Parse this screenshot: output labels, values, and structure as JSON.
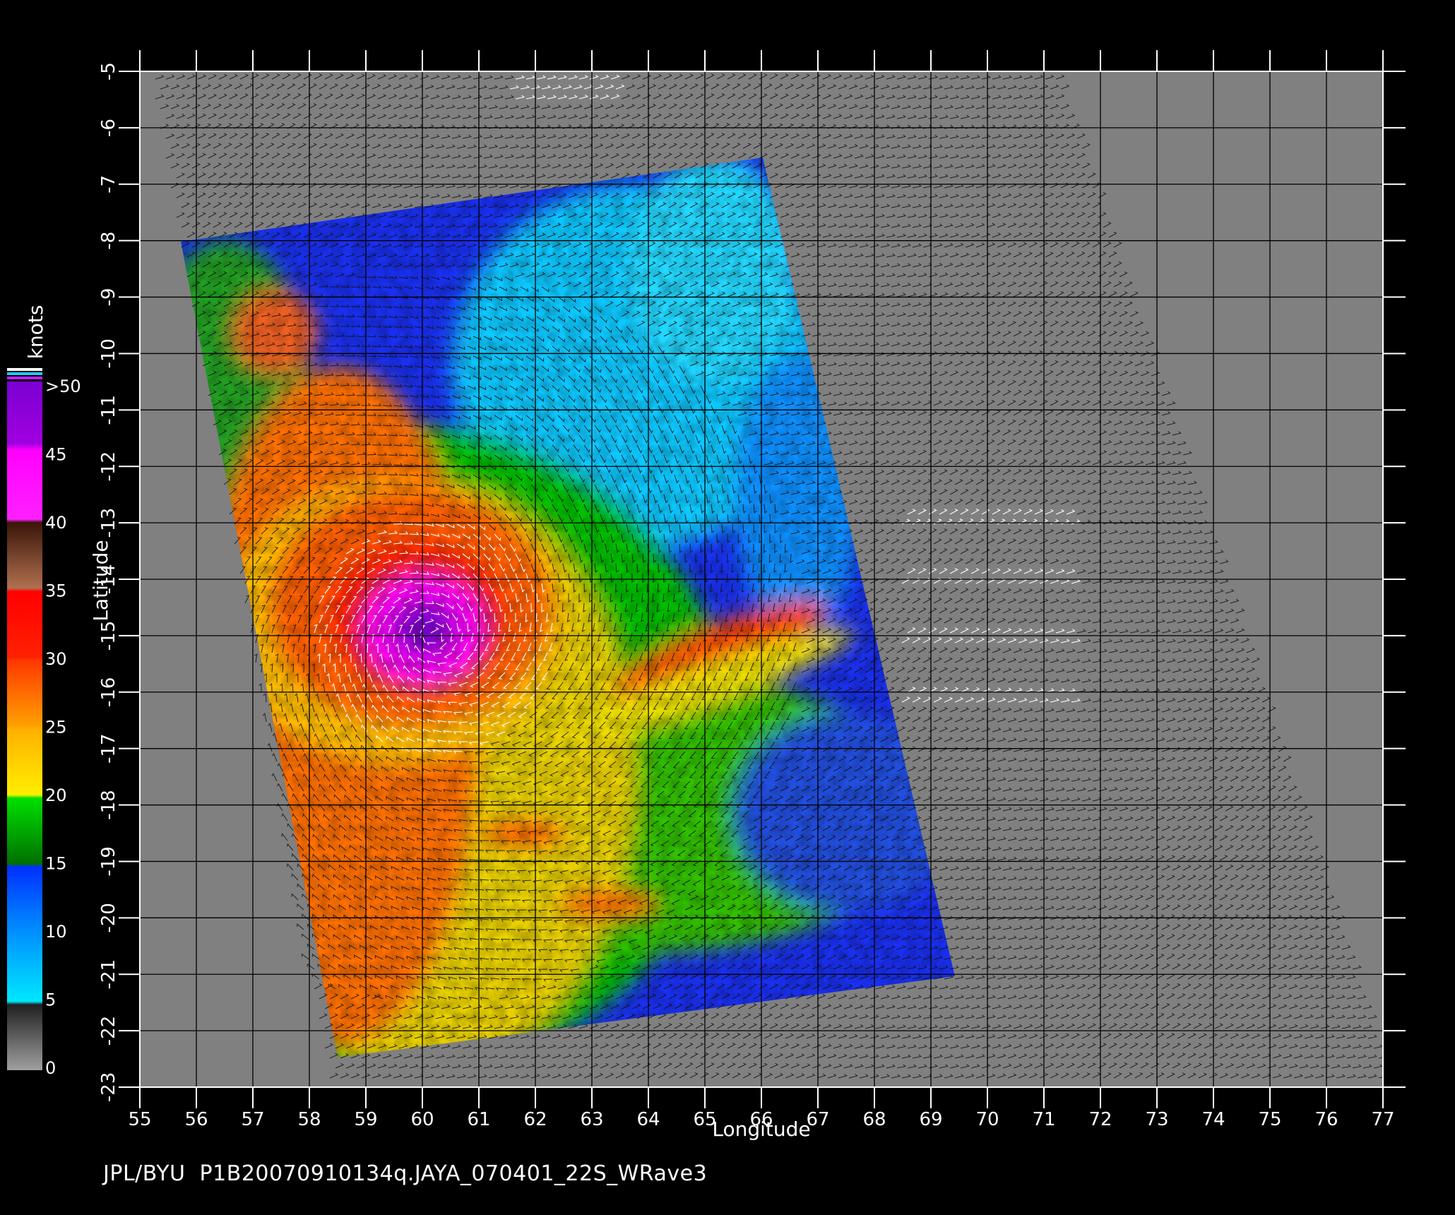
{
  "map": {
    "xlabel": "Longitude",
    "ylabel": "Latitude",
    "x_ticks": [
      "55",
      "56",
      "57",
      "58",
      "59",
      "60",
      "61",
      "62",
      "63",
      "64",
      "65",
      "66",
      "67",
      "68",
      "69",
      "70",
      "71",
      "72",
      "73",
      "74",
      "75",
      "76",
      "77"
    ],
    "y_ticks": [
      "-5",
      "-6",
      "-7",
      "-8",
      "-9",
      "-10",
      "-11",
      "-12",
      "-13",
      "-14",
      "-15",
      "-16",
      "-17",
      "-18",
      "-19",
      "-20",
      "-21",
      "-22",
      "-23"
    ],
    "lon_range": [
      55,
      77
    ],
    "lat_range": [
      -23,
      -5
    ],
    "background_color": "#808080",
    "storm_center": {
      "lon": 60.2,
      "lat": -15.0
    }
  },
  "colorbar": {
    "unit": "knots",
    "labels": [
      ">50",
      "45",
      "40",
      "35",
      "30",
      "25",
      "20",
      "15",
      "10",
      "5",
      "0"
    ],
    "levels": [
      50,
      45,
      40,
      35,
      30,
      25,
      20,
      15,
      10,
      5,
      0
    ],
    "colors": [
      "#7a00d0",
      "#b000e0",
      "#ff00ff",
      "#3a1508",
      "#b07050",
      "#ff0000",
      "#ff5000",
      "#ffa000",
      "#ffee00",
      "#00e000",
      "#007000",
      "#0030ff",
      "#0090ff",
      "#00e8ff",
      "#303030",
      "#909090"
    ]
  },
  "footer": {
    "text": "JPL/BYU  P1B20070910134q.JAYA_070401_22S_WRave3"
  }
}
